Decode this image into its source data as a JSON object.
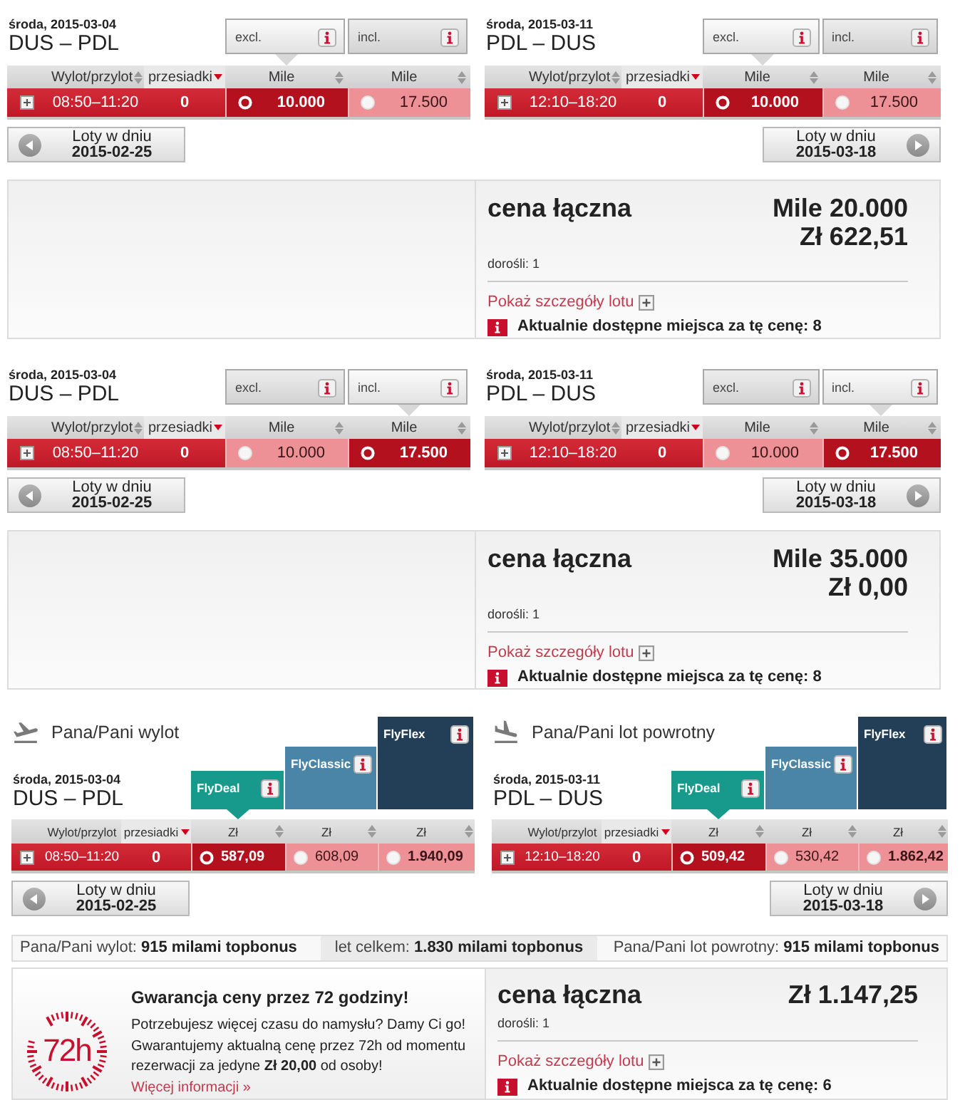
{
  "offers": [
    {
      "kind": "miles",
      "flights": [
        {
          "kind": "outbound",
          "date": "środa, 2015-03-04",
          "route": "DUS – PDL",
          "fare_tabs": [
            {
              "label": "excl.",
              "selected": true
            },
            {
              "label": "incl.",
              "selected": false
            }
          ],
          "columns": [
            {
              "label": "Wylot/przylot",
              "sortable": true,
              "sorted": false
            },
            {
              "label": "przesiadki",
              "sortable": true,
              "sorted": true
            },
            {
              "label": "Mile",
              "sortable": true,
              "sorted": false
            },
            {
              "label": "Mile",
              "sortable": true,
              "sorted": false
            }
          ],
          "flight": {
            "expanded": false,
            "time": "08:50–11:20",
            "stops": "0",
            "fares": [
              {
                "value": "10.000",
                "selected": true,
                "emphasized": true
              },
              {
                "value": "17.500",
                "selected": false,
                "emphasized": false
              }
            ]
          },
          "day_button": {
            "label": "Loty w dniu",
            "date": "2015-02-25"
          }
        },
        {
          "kind": "return",
          "date": "środa, 2015-03-11",
          "route": "PDL – DUS",
          "fare_tabs": [
            {
              "label": "excl.",
              "selected": true
            },
            {
              "label": "incl.",
              "selected": false
            }
          ],
          "columns": [
            {
              "label": "Wylot/przylot",
              "sortable": true,
              "sorted": false
            },
            {
              "label": "przesiadki",
              "sortable": true,
              "sorted": true
            },
            {
              "label": "Mile",
              "sortable": true,
              "sorted": false
            },
            {
              "label": "Mile",
              "sortable": true,
              "sorted": false
            }
          ],
          "flight": {
            "expanded": false,
            "time": "12:10–18:20",
            "stops": "0",
            "fares": [
              {
                "value": "10.000",
                "selected": true,
                "emphasized": true
              },
              {
                "value": "17.500",
                "selected": false,
                "emphasized": false
              }
            ]
          },
          "day_button": {
            "label": "Loty w dniu",
            "date": "2015-03-18"
          }
        }
      ],
      "summary": {
        "title": "cena łączna",
        "amounts": [
          "Mile 20.000",
          "Zł 622,51"
        ],
        "passengers": "dorośli: 1",
        "details_link": "Pokaż szczegóły lotu",
        "availability": "Aktualnie dostępne miejsca za tę cenę: 8"
      }
    },
    {
      "kind": "miles",
      "flights": [
        {
          "kind": "outbound",
          "date": "środa, 2015-03-04",
          "route": "DUS – PDL",
          "fare_tabs": [
            {
              "label": "excl.",
              "selected": false
            },
            {
              "label": "incl.",
              "selected": true
            }
          ],
          "columns": [
            {
              "label": "Wylot/przylot",
              "sortable": true,
              "sorted": false
            },
            {
              "label": "przesiadki",
              "sortable": true,
              "sorted": true
            },
            {
              "label": "Mile",
              "sortable": true,
              "sorted": false
            },
            {
              "label": "Mile",
              "sortable": true,
              "sorted": false
            }
          ],
          "flight": {
            "expanded": false,
            "time": "08:50–11:20",
            "stops": "0",
            "fares": [
              {
                "value": "10.000",
                "selected": false,
                "emphasized": false
              },
              {
                "value": "17.500",
                "selected": true,
                "emphasized": true
              }
            ]
          },
          "day_button": {
            "label": "Loty w dniu",
            "date": "2015-02-25"
          }
        },
        {
          "kind": "return",
          "date": "środa, 2015-03-11",
          "route": "PDL – DUS",
          "fare_tabs": [
            {
              "label": "excl.",
              "selected": false
            },
            {
              "label": "incl.",
              "selected": true
            }
          ],
          "columns": [
            {
              "label": "Wylot/przylot",
              "sortable": true,
              "sorted": false
            },
            {
              "label": "przesiadki",
              "sortable": true,
              "sorted": true
            },
            {
              "label": "Mile",
              "sortable": true,
              "sorted": false
            },
            {
              "label": "Mile",
              "sortable": true,
              "sorted": false
            }
          ],
          "flight": {
            "expanded": false,
            "time": "12:10–18:20",
            "stops": "0",
            "fares": [
              {
                "value": "10.000",
                "selected": false,
                "emphasized": false
              },
              {
                "value": "17.500",
                "selected": true,
                "emphasized": true
              }
            ]
          },
          "day_button": {
            "label": "Loty w dniu",
            "date": "2015-03-18"
          }
        }
      ],
      "summary": {
        "title": "cena łączna",
        "amounts": [
          "Mile 35.000",
          "Zł 0,00"
        ],
        "passengers": "dorośli: 1",
        "details_link": "Pokaż szczegóły lotu",
        "availability": "Aktualnie dostępne miejsca za tę cenę: 8"
      }
    },
    {
      "kind": "cash",
      "flights": [
        {
          "kind": "outbound",
          "heading": "Pana/Pani wylot",
          "date": "środa, 2015-03-04",
          "route": "DUS – PDL",
          "fare_tabs": [
            {
              "label": "FlyDeal",
              "selected": true,
              "color": "#17998b"
            },
            {
              "label": "FlyClassic",
              "selected": false,
              "color": "#4a84a6"
            },
            {
              "label": "FlyFlex",
              "selected": false,
              "color": "#223f57"
            }
          ],
          "columns": [
            {
              "label": "Wylot/przylot",
              "sortable": false,
              "sorted": false
            },
            {
              "label": "przesiadki",
              "sortable": true,
              "sorted": true
            },
            {
              "label": "Zł",
              "sortable": true,
              "sorted": false
            },
            {
              "label": "Zł",
              "sortable": true,
              "sorted": false
            },
            {
              "label": "Zł",
              "sortable": true,
              "sorted": false
            }
          ],
          "flight": {
            "expanded": false,
            "time": "08:50–11:20",
            "stops": "0",
            "fares": [
              {
                "value": "587,09",
                "selected": true,
                "emphasized": true
              },
              {
                "value": "608,09",
                "selected": false,
                "emphasized": false
              },
              {
                "value": "1.940,09",
                "selected": false,
                "emphasized": true
              }
            ]
          },
          "day_button": {
            "label": "Loty w dniu",
            "date": "2015-02-25"
          }
        },
        {
          "kind": "return",
          "heading": "Pana/Pani lot powrotny",
          "date": "środa, 2015-03-11",
          "route": "PDL – DUS",
          "fare_tabs": [
            {
              "label": "FlyDeal",
              "selected": true,
              "color": "#17998b"
            },
            {
              "label": "FlyClassic",
              "selected": false,
              "color": "#4a84a6"
            },
            {
              "label": "FlyFlex",
              "selected": false,
              "color": "#223f57"
            }
          ],
          "columns": [
            {
              "label": "Wylot/przylot",
              "sortable": false,
              "sorted": false
            },
            {
              "label": "przesiadki",
              "sortable": true,
              "sorted": true
            },
            {
              "label": "Zł",
              "sortable": true,
              "sorted": false
            },
            {
              "label": "Zł",
              "sortable": true,
              "sorted": false
            },
            {
              "label": "Zł",
              "sortable": true,
              "sorted": false
            }
          ],
          "flight": {
            "expanded": false,
            "time": "12:10–18:20",
            "stops": "0",
            "fares": [
              {
                "value": "509,42",
                "selected": true,
                "emphasized": true
              },
              {
                "value": "530,42",
                "selected": false,
                "emphasized": false
              },
              {
                "value": "1.862,42",
                "selected": false,
                "emphasized": true
              }
            ]
          },
          "day_button": {
            "label": "Loty w dniu",
            "date": "2015-03-18"
          }
        }
      ],
      "bonus_bar": [
        "Pana/Pani wylot: **915 milami topbonus**",
        "let celkem: **1.830 milami topbonus**",
        "Pana/Pani lot powrotny: **915 milami topbonus**"
      ],
      "guarantee": {
        "badge": "72h",
        "title": "Gwarancja ceny przez 72 godziny!",
        "text": "Potrzebujesz więcej czasu do namysłu? Damy Ci go! Gwarantujemy aktualną cenę przez 72h od momentu rezerwacji za jedyne **Zł 20,00** od osoby!",
        "link": "Więcej informacji »"
      },
      "summary": {
        "title": "cena łączna",
        "amounts": [
          "Zł 1.147,25"
        ],
        "passengers": "dorośli: 1",
        "details_link": "Pokaż szczegóły lotu",
        "availability": "Aktualnie dostępne miejsca za tę cenę: 6"
      }
    }
  ]
}
